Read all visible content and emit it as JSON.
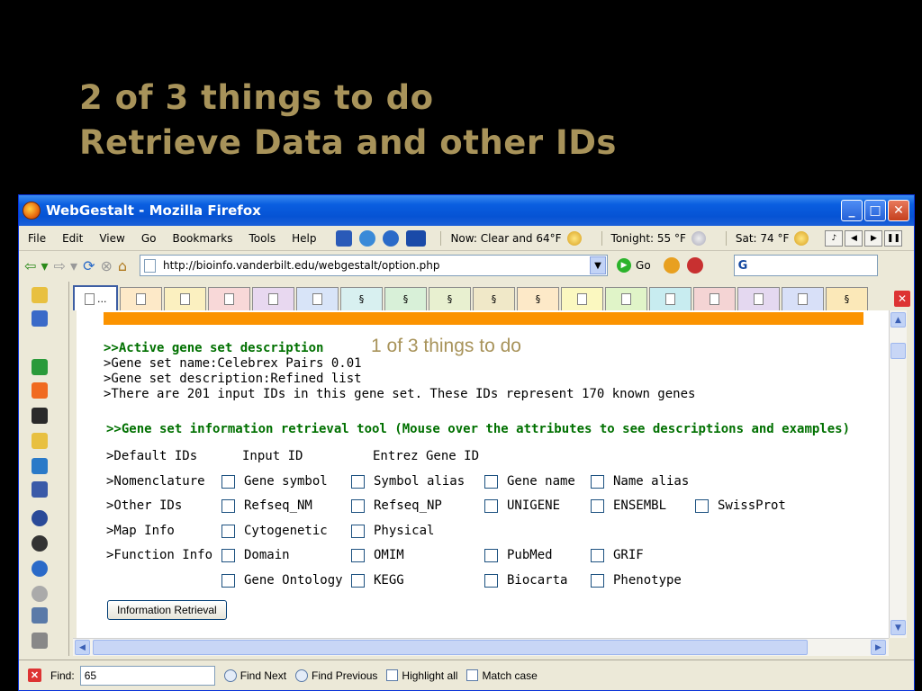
{
  "slide": {
    "title_line1": "2 of 3 things to do",
    "title_line2": "Retrieve Data and other IDs",
    "annotation": "1 of 3 things to do"
  },
  "window": {
    "title": "WebGestalt - Mozilla Firefox",
    "min": "_",
    "max": "□",
    "close": "✕"
  },
  "menu": {
    "items": [
      "File",
      "Edit",
      "View",
      "Go",
      "Bookmarks",
      "Tools",
      "Help"
    ],
    "weather_now": "Now: Clear and 64°F",
    "weather_tonight": "Tonight: 55 °F",
    "weather_sat": "Sat: 74 °F"
  },
  "nav": {
    "url": "http://bioinfo.vanderbilt.edu/webgestalt/option.php",
    "go_label": "Go",
    "search_logo": "G"
  },
  "tabs": {
    "active_label": "..."
  },
  "content": {
    "active_header": ">>Active gene set description",
    "gene_set_name": ">Gene set name:Celebrex Pairs 0.01",
    "gene_set_desc": ">Gene set description:Refined list",
    "input_ids": ">There are 201 input IDs in this gene set. These IDs represent 170 known genes",
    "tool_header": ">>Gene set information retrieval tool (Mouse over the attributes to see descriptions and examples)",
    "rows": [
      {
        "label": ">Default IDs",
        "items": [
          {
            "text": "Input ID",
            "checkbox": false
          },
          {
            "text": "Entrez Gene ID",
            "checkbox": false
          }
        ]
      },
      {
        "label": ">Nomenclature",
        "items": [
          {
            "text": "Gene symbol",
            "checkbox": true
          },
          {
            "text": "Symbol alias",
            "checkbox": true
          },
          {
            "text": "Gene name",
            "checkbox": true
          },
          {
            "text": "Name alias",
            "checkbox": true
          }
        ]
      },
      {
        "label": ">Other IDs",
        "items": [
          {
            "text": "Refseq_NM",
            "checkbox": true
          },
          {
            "text": "Refseq_NP",
            "checkbox": true
          },
          {
            "text": "UNIGENE",
            "checkbox": true
          },
          {
            "text": "ENSEMBL",
            "checkbox": true
          },
          {
            "text": "SwissProt",
            "checkbox": true
          }
        ]
      },
      {
        "label": ">Map Info",
        "items": [
          {
            "text": "Cytogenetic",
            "checkbox": true
          },
          {
            "text": "Physical",
            "checkbox": true
          }
        ]
      },
      {
        "label": ">Function Info",
        "items": [
          {
            "text": "Domain",
            "checkbox": true
          },
          {
            "text": "OMIM",
            "checkbox": true
          },
          {
            "text": "PubMed",
            "checkbox": true
          },
          {
            "text": "GRIF",
            "checkbox": true
          }
        ]
      },
      {
        "label": "",
        "items": [
          {
            "text": "Gene Ontology",
            "checkbox": true
          },
          {
            "text": "KEGG",
            "checkbox": true
          },
          {
            "text": "Biocarta",
            "checkbox": true
          },
          {
            "text": "Phenotype",
            "checkbox": true
          }
        ]
      }
    ],
    "retrieve_button": "Information Retrieval"
  },
  "findbar": {
    "label": "Find:",
    "value": "65",
    "find_next": "Find Next",
    "find_previous": "Find Previous",
    "highlight_all": "Highlight all",
    "match_case": "Match case"
  }
}
